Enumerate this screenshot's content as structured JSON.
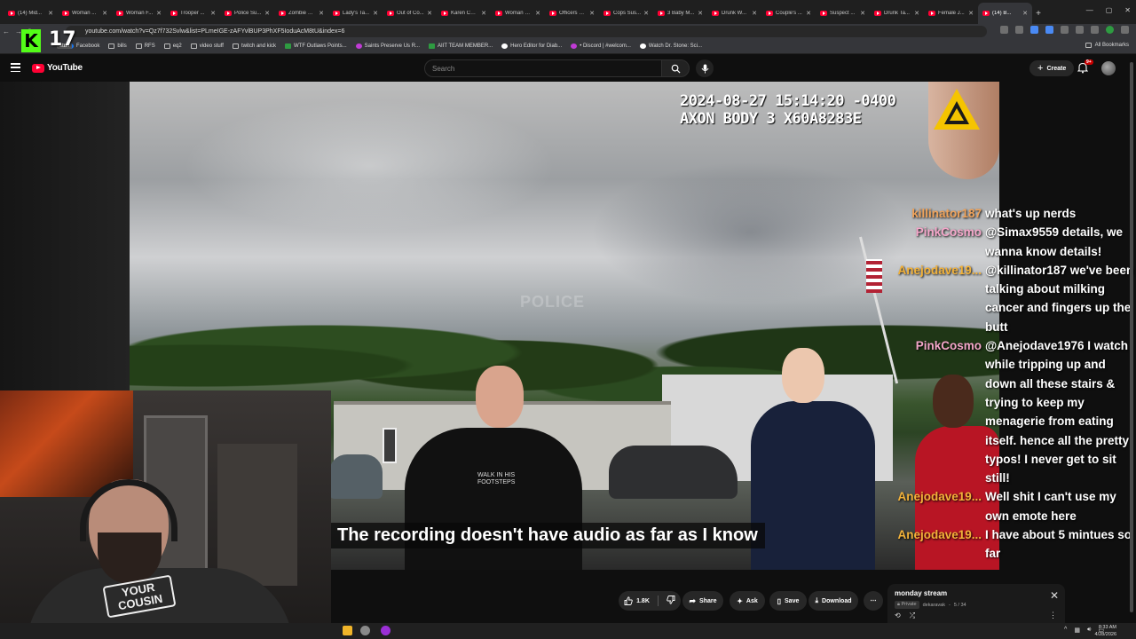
{
  "browser": {
    "tabs": [
      {
        "title": "(14) Mid..."
      },
      {
        "title": "Woman ..."
      },
      {
        "title": "Woman F..."
      },
      {
        "title": "Trooper ..."
      },
      {
        "title": "Police Su..."
      },
      {
        "title": "Zombie W..."
      },
      {
        "title": "Lady's Ta..."
      },
      {
        "title": "Out of Co..."
      },
      {
        "title": "Karen Cal..."
      },
      {
        "title": "Woman S..."
      },
      {
        "title": "Officers G..."
      },
      {
        "title": "Cops Sus..."
      },
      {
        "title": "3 Baby M..."
      },
      {
        "title": "Drunk W..."
      },
      {
        "title": "Couple's ..."
      },
      {
        "title": "Suspect ..."
      },
      {
        "title": "Drunk Ta..."
      },
      {
        "title": "Female J..."
      },
      {
        "title": "(14) B..."
      }
    ],
    "active_tab_index": 18,
    "url": "youtube.com/watch?v=Qz7f732Svlw&list=PLmeIGE-zAFYvlBUP3PhXF5IoduAcM8tU&index=6",
    "bookmarks": [
      {
        "label": "Facebook",
        "icon": "facebook-icon"
      },
      {
        "label": "bills",
        "icon": "folder-icon"
      },
      {
        "label": "RFS",
        "icon": "folder-icon"
      },
      {
        "label": "eq2",
        "icon": "folder-icon"
      },
      {
        "label": "video stuff",
        "icon": "folder-icon"
      },
      {
        "label": "twitch and kick",
        "icon": "folder-icon"
      },
      {
        "label": "WTF Outlaws Points...",
        "icon": "green-icon"
      },
      {
        "label": "Saints Preserve Us R...",
        "icon": "purple-icon"
      },
      {
        "label": "AIIT TEAM MEMBER...",
        "icon": "green-icon"
      },
      {
        "label": "Hero Editor for Diab...",
        "icon": "white-icon"
      },
      {
        "label": "• Discord | #welcom...",
        "icon": "purple-icon"
      },
      {
        "label": "Watch Dr. Stone: Sci...",
        "icon": "white-icon"
      }
    ],
    "all_bookmarks_label": "All Bookmarks",
    "extension_hover_label": "stuff"
  },
  "stream_overlay": {
    "logo_letter": "K",
    "viewer_count": "17"
  },
  "youtube": {
    "logo_text": "YouTube",
    "search_placeholder": "Search",
    "create_label": "Create",
    "notification_count": "9+",
    "actions": {
      "like_count": "1.8K",
      "share_label": "Share",
      "ask_label": "Ask",
      "save_label": "Save",
      "download_label": "Download"
    },
    "playlist": {
      "title": "monday stream",
      "privacy": "Private",
      "owner": "dekaravak",
      "position": "5 / 34"
    }
  },
  "video": {
    "timestamp": "2024-08-27 15:14:20 -0400",
    "device": "AXON BODY 3 X60A8283E",
    "watermark": "POLICE",
    "caption": "The recording doesn't have audio as far as I know",
    "shirt_print": "WALK IN HIS FOOTSTEPS"
  },
  "webcam": {
    "shirt_text": "YOUR COUSIN"
  },
  "chat": [
    {
      "user": "killinator187",
      "color": "#f0a35a",
      "message": "what's up nerds"
    },
    {
      "user": "PinkCosmo",
      "color": "#f4a6c9",
      "message": "@Simax9559 details, we wanna know details!"
    },
    {
      "user": "Anejodave19...",
      "color": "#f2b23a",
      "message": "@killinator187 we've been talking about milking cancer and fingers up the butt"
    },
    {
      "user": "PinkCosmo",
      "color": "#f4a6c9",
      "message": "@Anejodave1976 I watch while tripping up and down all these stairs & trying to keep my menagerie from eating itself. hence all the pretty typos! I never get to sit still!"
    },
    {
      "user": "Anejodave19...",
      "color": "#f2b23a",
      "message": "Well shit I can't use my own emote here"
    },
    {
      "user": "Anejodave19...",
      "color": "#f2b23a",
      "message": "I have about 5 mintues so far"
    }
  ],
  "taskbar": {
    "time": "8:33 AM",
    "date": "4/28/2026"
  }
}
